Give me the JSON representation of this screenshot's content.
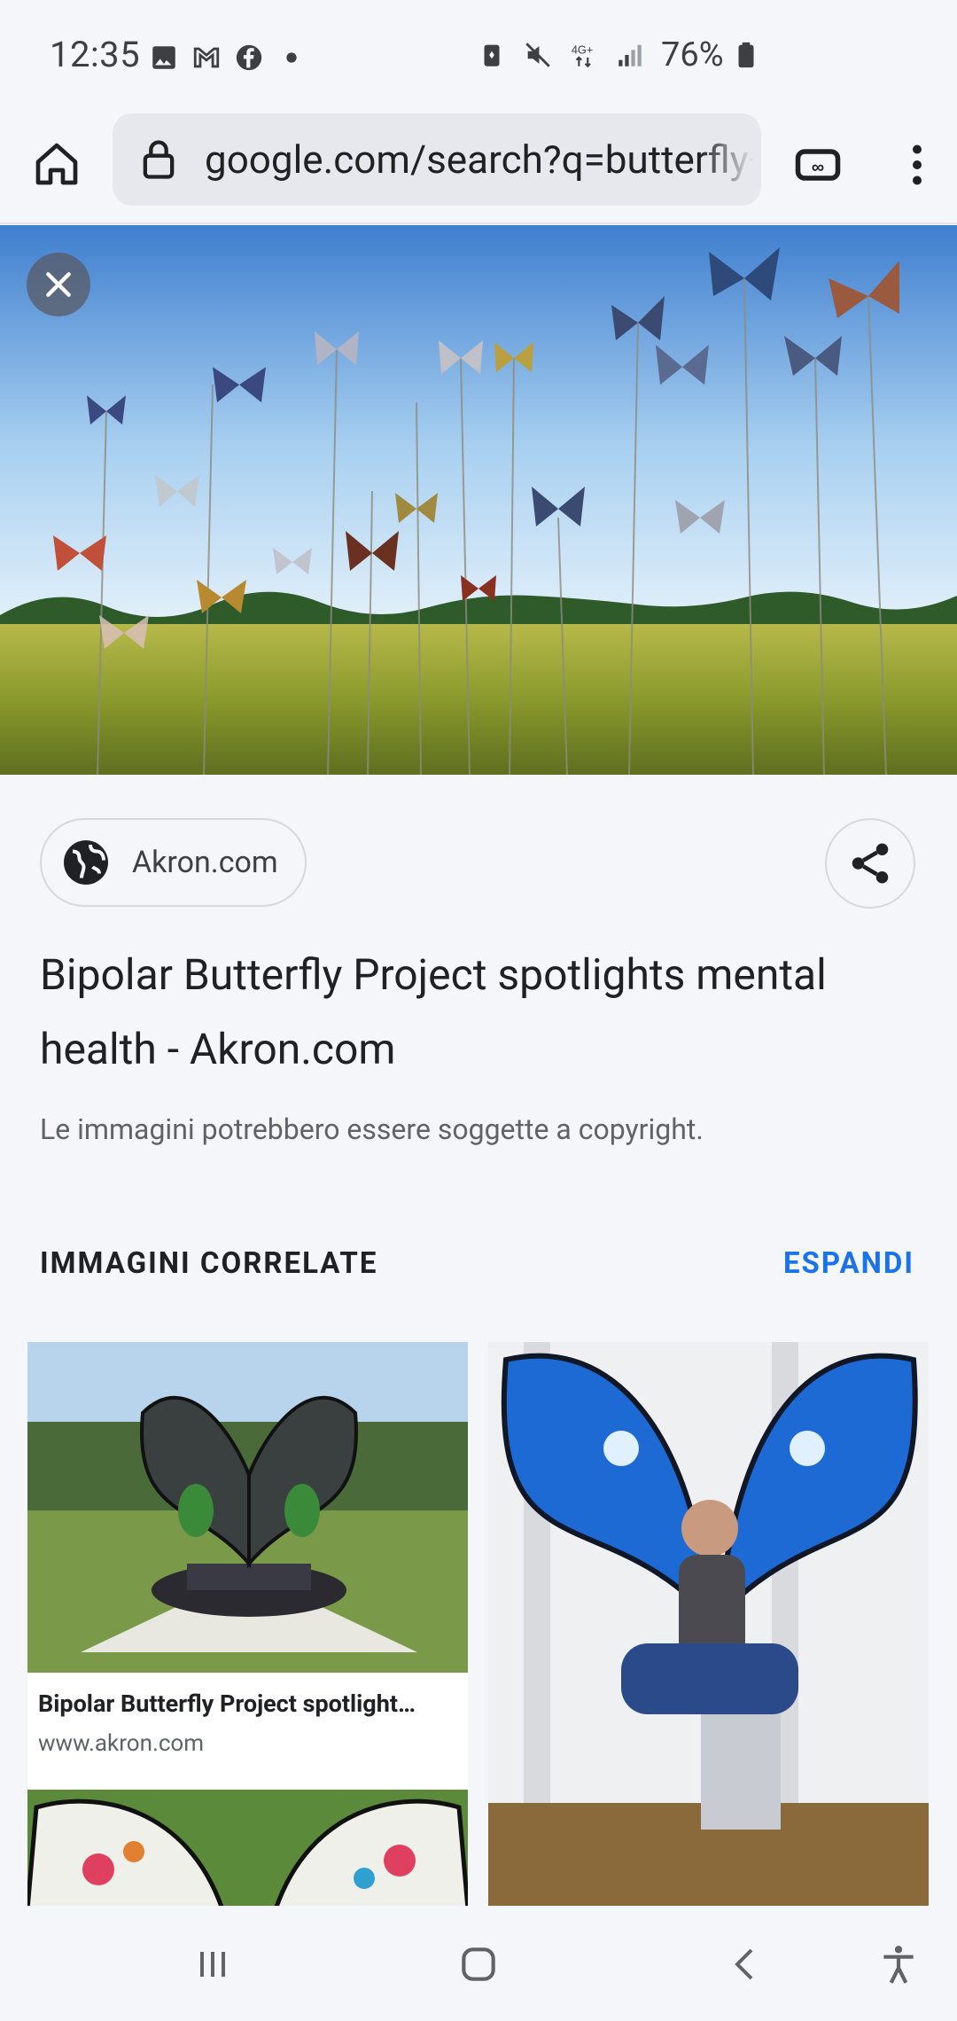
{
  "status_bar": {
    "time": "12:35",
    "battery": "76%",
    "icons": [
      "gallery-icon",
      "gmail-icon",
      "facebook-icon",
      "dot-icon",
      "alarm-icon",
      "mute-icon",
      "network-4g-icon",
      "signal-icon",
      "battery-icon"
    ]
  },
  "browser": {
    "url": "google.com/search?q=butterfly+",
    "icons": [
      "home-icon",
      "lock-icon",
      "tab-switcher-icon",
      "more-vert-icon"
    ]
  },
  "hero": {
    "close_icon": "close-icon",
    "description": "Field of metal butterfly sculptures on poles"
  },
  "source": {
    "label": "Akron.com",
    "icon": "globe-icon",
    "share_icon": "share-icon"
  },
  "result": {
    "title": "Bipolar Butterfly Project spotlights mental health - Akron.com",
    "copyright": "Le immagini potrebbero essere soggette a copyright."
  },
  "related": {
    "header": "IMMAGINI CORRELATE",
    "expand": "ESPANDI",
    "cards": [
      {
        "title": "Bipolar Butterfly Project spotlight…",
        "url": "www.akron.com"
      },
      {
        "title": "",
        "url": ""
      },
      {
        "title": "",
        "url": ""
      }
    ]
  },
  "nav": {
    "icons": [
      "recent-apps-icon",
      "home-nav-icon",
      "back-icon",
      "accessibility-icon"
    ]
  },
  "colors": {
    "background": "#f4f6fa",
    "accent": "#1a73e8",
    "text": "#202124",
    "muted": "#5f6368"
  }
}
